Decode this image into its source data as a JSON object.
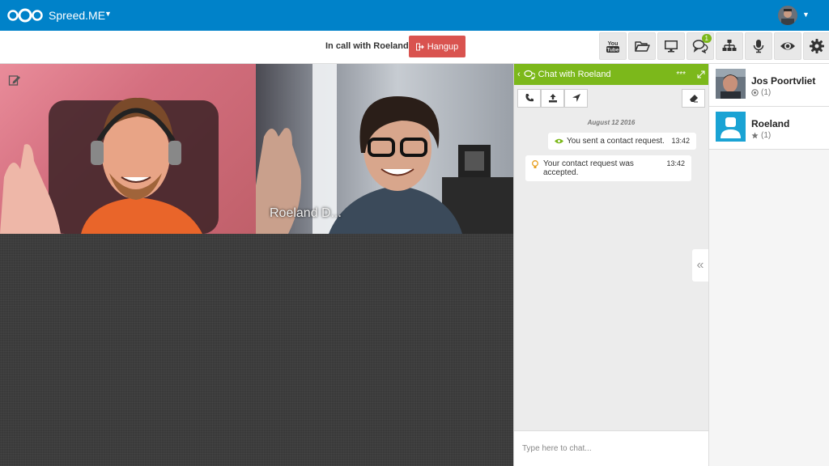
{
  "app": {
    "name": "Spreed.ME"
  },
  "call": {
    "status": "In call with Roeland",
    "hangup_label": "Hangup"
  },
  "toolbar": {
    "chat_badge": "1"
  },
  "video": {
    "remote_name": "Roeland D..."
  },
  "chat": {
    "title": "Chat with Roeland",
    "more": "***",
    "date": "August 12 2016",
    "messages": [
      {
        "text": "You sent a contact request.",
        "time": "13:42"
      },
      {
        "text": "Your contact request was accepted.",
        "time": "13:42"
      }
    ],
    "input_placeholder": "Type here to chat..."
  },
  "contacts": [
    {
      "name": "Jos Poortvliet",
      "status": "(1)"
    },
    {
      "name": "Roeland",
      "status": "(1)"
    }
  ],
  "colors": {
    "topbar": "#0082c9",
    "chat_header": "#7cb81b",
    "hangup": "#d9534f",
    "contact_avatar": "#1aa3d4"
  }
}
